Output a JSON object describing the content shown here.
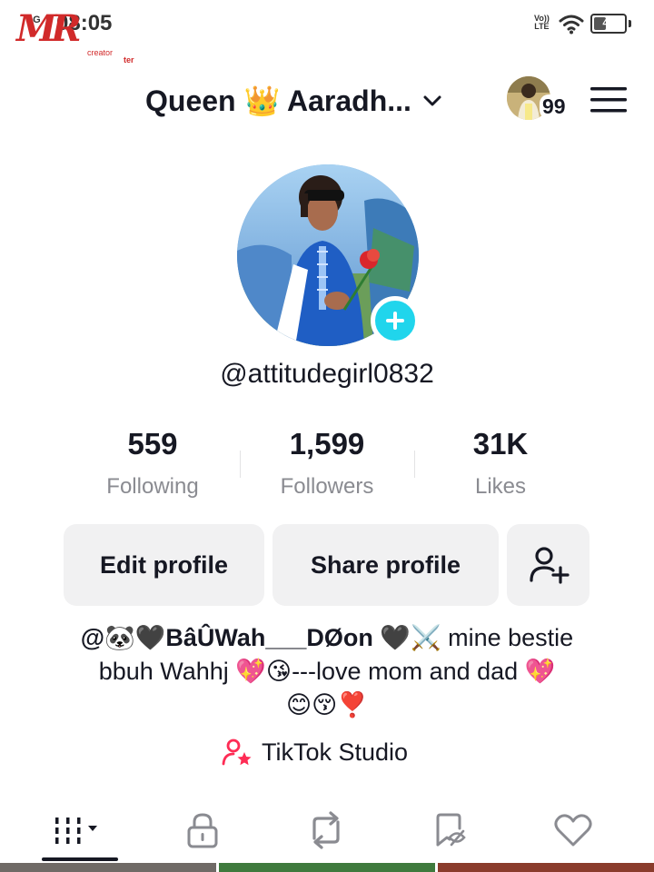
{
  "status_bar": {
    "time": "08:05",
    "signal": "4G",
    "network": "Vo))\nLTE",
    "battery": "48",
    "battery_level": 0.48
  },
  "watermark": {
    "main": "MR",
    "sub1": "creator",
    "sub2": "ter"
  },
  "header": {
    "display_name": "Queen 👑 Aaradh...",
    "switch_badge": "99"
  },
  "profile": {
    "username": "@attitudegirl0832",
    "stats": [
      {
        "value": "559",
        "label": "Following"
      },
      {
        "value": "1,599",
        "label": "Followers"
      },
      {
        "value": "31K",
        "label": "Likes"
      }
    ]
  },
  "actions": {
    "edit_label": "Edit profile",
    "share_label": "Share profile"
  },
  "bio": {
    "mention": "@🐼🖤BâÛWah___DØon",
    "line1_rest": " 🖤⚔️ mine bestie",
    "line2": "bbuh Wahhj 💖😘---love mom and dad 💖",
    "line3": "😊😚❣️"
  },
  "studio": {
    "label": "TikTok Studio"
  },
  "tabs": [
    {
      "name": "videos",
      "icon": "grid-icon",
      "active": true
    },
    {
      "name": "private",
      "icon": "lock-icon"
    },
    {
      "name": "reposts",
      "icon": "repost-icon"
    },
    {
      "name": "favorites",
      "icon": "bookmark-icon"
    },
    {
      "name": "liked",
      "icon": "heart-icon"
    }
  ],
  "colors": {
    "accent_cyan": "#20d5ec",
    "text_primary": "#161823",
    "text_secondary": "#8a8b91",
    "button_bg": "#f1f1f2",
    "studio_pink": "#fe2c55"
  }
}
